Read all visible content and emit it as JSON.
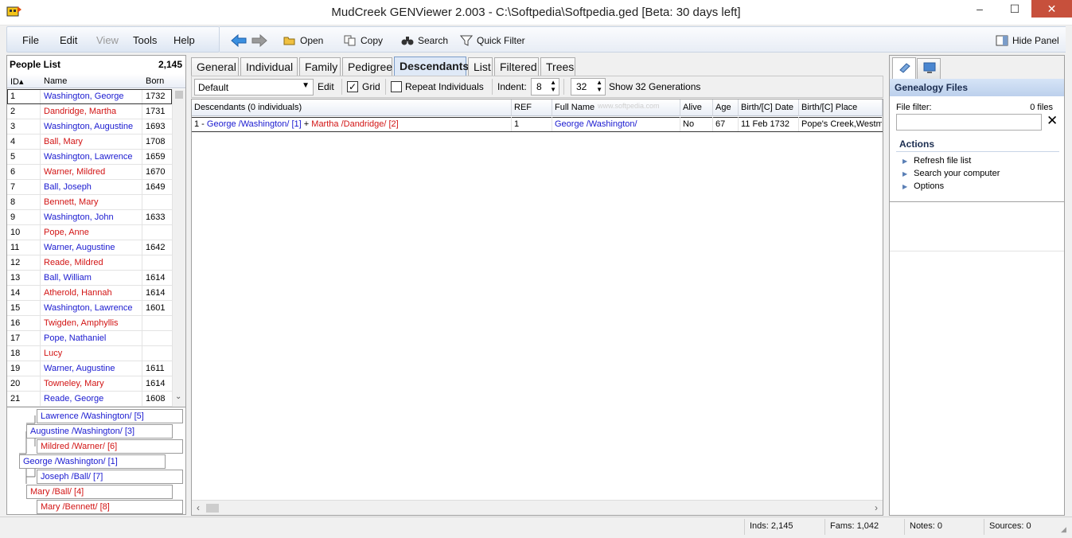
{
  "window": {
    "title": "MudCreek GENViewer 2.003 - C:\\Softpedia\\Softpedia.ged [Beta: 30 days left]",
    "minimize": "–",
    "maximize": "☐",
    "close": "✕"
  },
  "menu": {
    "file": "File",
    "edit": "Edit",
    "view": "View",
    "tools": "Tools",
    "help": "Help"
  },
  "toolbar": {
    "open": "Open",
    "copy": "Copy",
    "search": "Search",
    "quick_filter": "Quick Filter",
    "hide_panel": "Hide Panel"
  },
  "people_list": {
    "title": "People List",
    "count": "2,145",
    "columns": {
      "id": "ID",
      "name": "Name",
      "born": "Born"
    },
    "rows": [
      {
        "id": "1",
        "name": "Washington, George",
        "born": "1732",
        "sex": "m"
      },
      {
        "id": "2",
        "name": "Dandridge, Martha",
        "born": "1731",
        "sex": "f"
      },
      {
        "id": "3",
        "name": "Washington, Augustine",
        "born": "1693",
        "sex": "m"
      },
      {
        "id": "4",
        "name": "Ball, Mary",
        "born": "1708",
        "sex": "f"
      },
      {
        "id": "5",
        "name": "Washington, Lawrence",
        "born": "1659",
        "sex": "m"
      },
      {
        "id": "6",
        "name": "Warner, Mildred",
        "born": "1670",
        "sex": "f"
      },
      {
        "id": "7",
        "name": "Ball, Joseph",
        "born": "1649",
        "sex": "m"
      },
      {
        "id": "8",
        "name": "Bennett, Mary",
        "born": "",
        "sex": "f"
      },
      {
        "id": "9",
        "name": "Washington, John",
        "born": "1633",
        "sex": "m"
      },
      {
        "id": "10",
        "name": "Pope, Anne",
        "born": "",
        "sex": "f"
      },
      {
        "id": "11",
        "name": "Warner, Augustine",
        "born": "1642",
        "sex": "m"
      },
      {
        "id": "12",
        "name": "Reade, Mildred",
        "born": "",
        "sex": "f"
      },
      {
        "id": "13",
        "name": "Ball, William",
        "born": "1614",
        "sex": "m"
      },
      {
        "id": "14",
        "name": "Atherold, Hannah",
        "born": "1614",
        "sex": "f"
      },
      {
        "id": "15",
        "name": "Washington, Lawrence",
        "born": "1601",
        "sex": "m"
      },
      {
        "id": "16",
        "name": "Twigden, Amphyllis",
        "born": "",
        "sex": "f"
      },
      {
        "id": "17",
        "name": "Pope, Nathaniel",
        "born": "",
        "sex": "m"
      },
      {
        "id": "18",
        "name": "Lucy",
        "born": "",
        "sex": "f"
      },
      {
        "id": "19",
        "name": "Warner, Augustine",
        "born": "1611",
        "sex": "m"
      },
      {
        "id": "20",
        "name": "Towneley, Mary",
        "born": "1614",
        "sex": "f"
      },
      {
        "id": "21",
        "name": "Reade, George",
        "born": "1608",
        "sex": "m"
      }
    ]
  },
  "pedigree": {
    "lawrence": "Lawrence /Washington/ [5]",
    "augustine": "Augustine /Washington/ [3]",
    "mildred": "Mildred /Warner/ [6]",
    "george": "George /Washington/ [1]",
    "joseph": "Joseph /Ball/ [7]",
    "mary_ball": "Mary /Ball/ [4]",
    "mary_bennett": "Mary /Bennett/ [8]"
  },
  "tabs": [
    "General",
    "Individual",
    "Family",
    "Pedigree",
    "Descendants",
    "List",
    "Filtered",
    "Trees"
  ],
  "descendants": {
    "layout_select": "Default",
    "edit": "Edit",
    "grid_label": "Grid",
    "grid_checked": true,
    "repeat_label": "Repeat Individuals",
    "repeat_checked": false,
    "indent_label": "Indent:",
    "indent_value": "8",
    "generations_value": "32",
    "generations_label": "Show 32 Generations",
    "columns": {
      "desc": "Descendants (0 individuals)",
      "ref": "REF",
      "full_name": "Full Name",
      "alive": "Alive",
      "age": "Age",
      "birth_date": "Birth/[C] Date",
      "birth_place": "Birth/[C] Place"
    },
    "row": {
      "prefix": "1 - ",
      "husband": "George /Washington/ [1]",
      "plus": " + ",
      "wife": "Martha /Dandridge/ [2]",
      "ref": "1",
      "full_name": "George /Washington/",
      "alive": "No",
      "age": "67",
      "birth_date": "11 Feb 1732",
      "birth_place": "Pope's Creek,Westmoreland"
    },
    "watermark": "www.softpedia.com"
  },
  "right_panel": {
    "title": "Genealogy Files",
    "file_filter_label": "File filter:",
    "file_count": "0 files",
    "file_filter_value": "",
    "actions_title": "Actions",
    "actions": [
      "Refresh file list",
      "Search your computer",
      "Options"
    ]
  },
  "status": {
    "inds": "Inds: 2,145",
    "fams": "Fams: 1,042",
    "notes": "Notes: 0",
    "sources": "Sources: 0"
  },
  "colors": {
    "male": "#1a1ad0",
    "female": "#d21414",
    "accent": "#7a9cc9"
  }
}
